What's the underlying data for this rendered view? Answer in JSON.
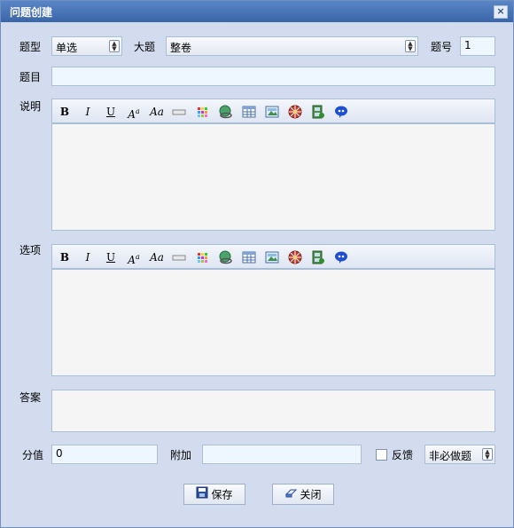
{
  "window": {
    "title": "问题创建",
    "close_glyph": "×"
  },
  "header": {
    "type_label": "题型",
    "type_value": "单选",
    "section_label": "大题",
    "section_value": "整卷",
    "number_label": "题号",
    "number_value": "1"
  },
  "question": {
    "label": "题目",
    "value": ""
  },
  "description": {
    "label": "说明"
  },
  "options": {
    "label": "选项"
  },
  "answer": {
    "label": "答案"
  },
  "toolbar": {
    "bold": "B",
    "italic": "I",
    "underline": "U",
    "font_size": "A",
    "font_size_sup": "a",
    "font_style": "Aa",
    "icons": [
      "bold-icon",
      "italic-icon",
      "underline-icon",
      "font-size-icon",
      "font-family-icon",
      "horizontal-rule-icon",
      "color-icon",
      "link-icon",
      "table-icon",
      "image-icon",
      "media-icon",
      "flash-icon",
      "emoticon-icon"
    ]
  },
  "score": {
    "label": "分值",
    "value": "0"
  },
  "extra": {
    "label": "附加",
    "value": ""
  },
  "feedback": {
    "label": "反馈",
    "checked": false
  },
  "required": {
    "value": "非必做题"
  },
  "buttons": {
    "save": "保存",
    "close": "关闭"
  },
  "colors": {
    "title_bar": "#3a65a9",
    "window_bg": "#d3dcee",
    "field_bg": "#eef6ff"
  }
}
